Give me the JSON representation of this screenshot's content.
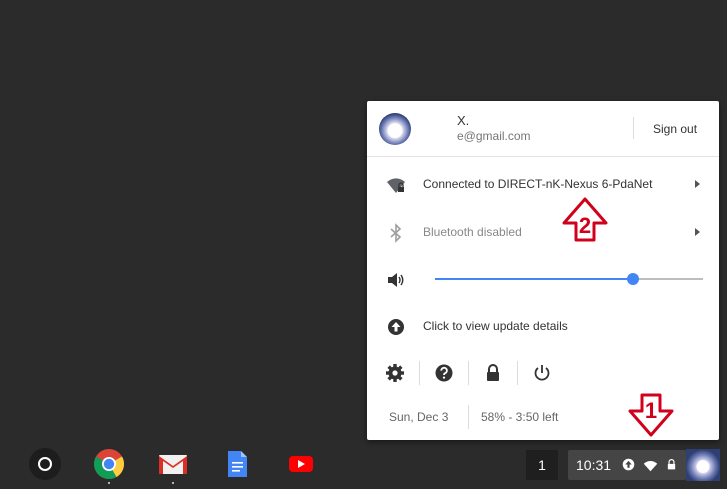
{
  "user": {
    "name": "X.",
    "email": "e@gmail.com",
    "sign_out_label": "Sign out"
  },
  "network": {
    "label": "Connected to DIRECT-nK-Nexus 6-PdaNet",
    "icon": "wifi-locked-icon"
  },
  "bluetooth": {
    "label": "Bluetooth disabled",
    "icon": "bluetooth-icon"
  },
  "volume": {
    "icon": "speaker-icon",
    "level": 0.74
  },
  "update": {
    "label": "Click to view update details",
    "icon": "update-arrow-icon"
  },
  "actions": [
    "settings-icon",
    "help-icon",
    "lock-icon",
    "power-icon"
  ],
  "status": {
    "date": "Sun, Dec 3",
    "battery": "58% - 3:50 left"
  },
  "shelf": {
    "apps": [
      "launcher-icon",
      "chrome-icon",
      "gmail-icon",
      "docs-icon",
      "youtube-icon"
    ],
    "window_count": "1",
    "clock": "10:31"
  },
  "annotations": {
    "arrow_1": "1",
    "arrow_2": "2",
    "color": "#d0021b"
  },
  "colors": {
    "accent": "#4285f4",
    "desktop": "#2b2b2b"
  }
}
